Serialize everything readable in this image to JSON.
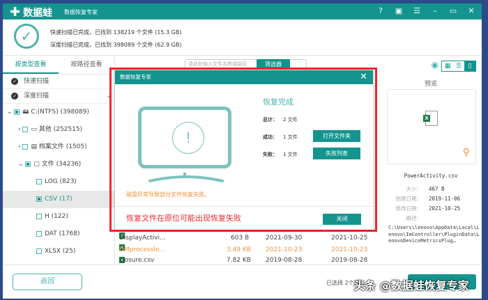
{
  "app": {
    "brand": "数据蛙",
    "subtitle": "数据恢复专家"
  },
  "window_controls": [
    "help-icon",
    "save-icon",
    "menu-icon",
    "minimize-icon",
    "maximize-icon",
    "close-icon"
  ],
  "scan": {
    "quick": "快速扫描已完成，已找到 138219 个文件 (15.3 GB)",
    "deep": "深度扫描已完成，已找到 398089 个文件 (62.9 GB)"
  },
  "left": {
    "tabs": [
      "按类型查看",
      "按路径查看"
    ],
    "scans": [
      "快速扫描",
      "深度扫描"
    ],
    "tree": [
      {
        "label": "C:(NTFS) (398089)"
      },
      {
        "label": "其他 (252515)"
      },
      {
        "label": "档案文件 (1505)"
      },
      {
        "label": "文件 (34236)"
      },
      {
        "label": "LOG (823)"
      },
      {
        "label": "CSV (17)"
      },
      {
        "label": "H (122)"
      },
      {
        "label": "DAT (1768)"
      },
      {
        "label": "XLSX (25)"
      }
    ]
  },
  "toolbar": {
    "search_placeholder": "请此处输入文件名称或路径",
    "filter": "筛选器"
  },
  "files": [
    {
      "name": "DisplayActivi...",
      "size": "603  B",
      "created": "2021-09-30",
      "modified": "2021-10-25"
    },
    {
      "name": "DMprocesslo...",
      "size": "3.49 KB",
      "created": "2021-10-23",
      "modified": "2021-10-23"
    },
    {
      "name": "closure.csv",
      "size": "7.82 KB",
      "created": "2019-08-28",
      "modified": "2019-08-28"
    }
  ],
  "preview": {
    "title": "预览",
    "filename": "PowerActivity.csv",
    "size_label": "大小：",
    "size": "467  B",
    "created_label": "创建日期：",
    "created": "2019-11-06",
    "modified_label": "修改日期：",
    "modified": "2021-10-25",
    "path_label": "路径：",
    "path": "C:\\Users\\lenovo\\AppData\\Local\\Lenovo\\ImController\\PluginData\\LenovoDeviceMetricsPlug…"
  },
  "bottom": {
    "back": "返回",
    "selected": "已选择 2个项目",
    "watermark": "头条 @数据蛙恢复专家"
  },
  "dialog": {
    "title": "数据恢复专家",
    "heading": "恢复完成",
    "total_label": "总计：",
    "total": "2 文件",
    "success_label": "成功：",
    "success": "1 文件",
    "fail_label": "失败：",
    "fail": "1 文件",
    "open_folder": "打开文件夹",
    "fail_list": "失败列表",
    "warning": "磁盘异常导致部分文件恢复失败。",
    "annotation": "恢复文件在原位可能出现恢复失败",
    "close": "关闭"
  },
  "colors": {
    "accent": "#13948f",
    "warning": "#f0913a",
    "annotation": "#f2262d"
  }
}
